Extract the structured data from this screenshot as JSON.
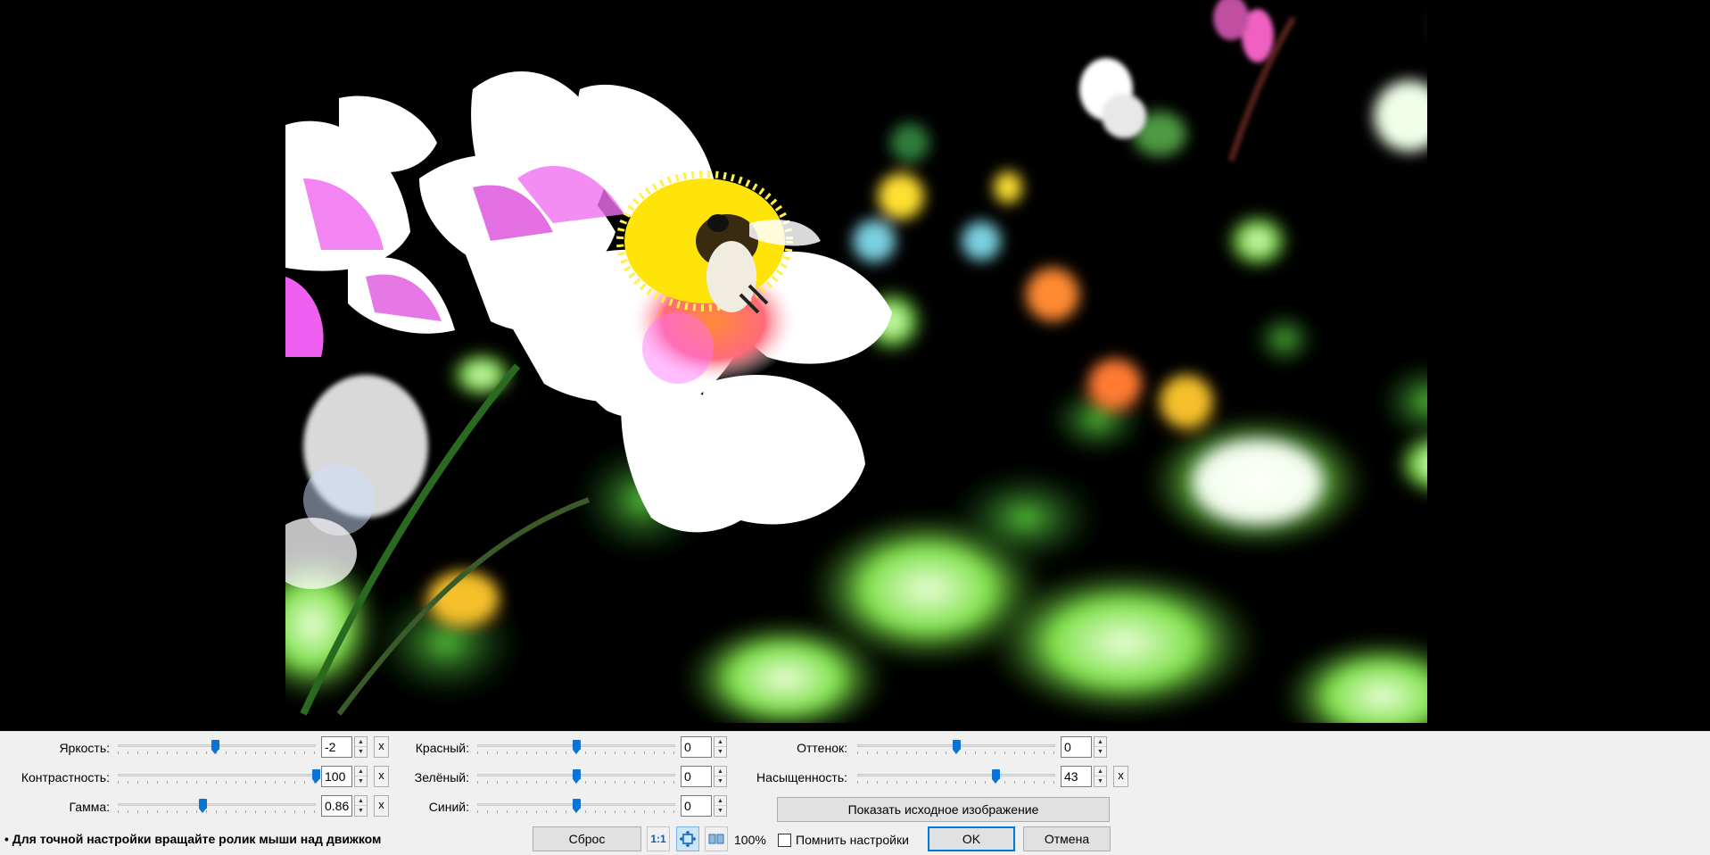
{
  "adjustments": {
    "left": [
      {
        "label": "Яркость:",
        "value": "-2",
        "position": 0.49,
        "has_reset": true
      },
      {
        "label": "Контрастность:",
        "value": "100",
        "position": 1.0,
        "has_reset": true
      },
      {
        "label": "Гамма:",
        "value": "0.86",
        "position": 0.43,
        "has_reset": true
      }
    ],
    "middle": [
      {
        "label": "Красный:",
        "value": "0",
        "position": 0.5
      },
      {
        "label": "Зелёный:",
        "value": "0",
        "position": 0.5
      },
      {
        "label": "Синий:",
        "value": "0",
        "position": 0.5
      }
    ],
    "right": [
      {
        "label": "Оттенок:",
        "value": "0",
        "position": 0.5,
        "has_reset": false
      },
      {
        "label": "Насыщенность:",
        "value": "43",
        "position": 0.7,
        "has_reset": true
      }
    ],
    "reset_glyph": "x"
  },
  "buttons": {
    "show_original": "Показать исходное изображение",
    "reset": "Сброс",
    "ok": "OK",
    "cancel": "Отмена"
  },
  "toolbar": {
    "actual_size": "1:1",
    "fit_icon": "fit-to-window-icon",
    "compare_icon": "split-compare-icon",
    "zoom": "100%"
  },
  "remember_settings": {
    "label": "Помнить настройки",
    "checked": false
  },
  "hint": "• Для точной настройки вращайте ролик мыши над движком",
  "colors": {
    "accent": "#0a74d4",
    "panel_bg": "#f0f0f0",
    "default_border": "#0078d7"
  }
}
